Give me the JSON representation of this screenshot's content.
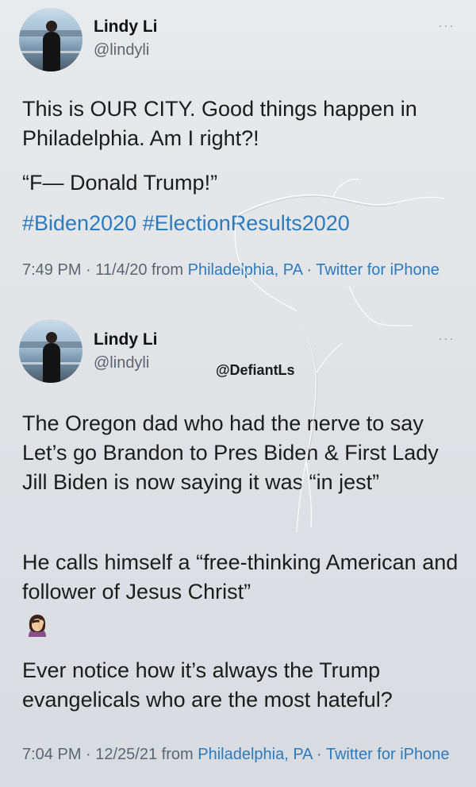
{
  "tweets": [
    {
      "name": "Lindy Li",
      "handle": "@lindyli",
      "more": "···",
      "paragraphs": [
        "This is OUR CITY. Good things happen in Philadelphia. Am I right?!",
        "“F— Donald Trump!”"
      ],
      "hashtags": "#Biden2020 #ElectionResults2020",
      "meta": {
        "time": "7:49 PM · 11/4/20 from ",
        "location": "Philadelphia, PA",
        "sep": " · ",
        "client": "Twitter for iPhone"
      }
    },
    {
      "name": "Lindy Li",
      "handle": "@lindyli",
      "more": "···",
      "paragraphs": [
        "The Oregon dad who had the nerve to say Let’s go Brandon to Pres Biden & First Lady Jill Biden is now saying it was “in jest”",
        "He calls himself a “free-thinking American and follower of Jesus Christ”",
        "Ever notice how it’s always the Trump evangelicals who are the most hateful?"
      ],
      "emoji": "woman-facepalming-icon",
      "meta": {
        "time": "7:04 PM · 12/25/21 from ",
        "location": "Philadelphia, PA",
        "sep": " · ",
        "client": "Twitter for iPhone"
      }
    }
  ],
  "watermark": "@DefiantLs"
}
